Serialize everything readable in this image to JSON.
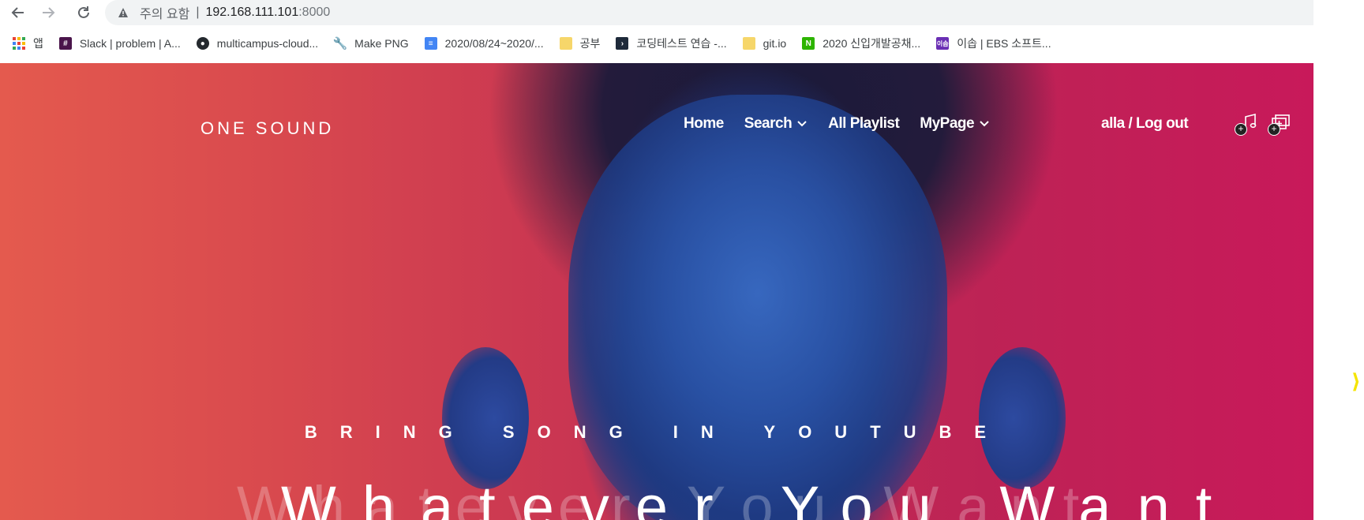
{
  "browser": {
    "security_label": "주의 요함",
    "url_separator": "|",
    "url_host": "192.168.111.101",
    "url_port": ":8000",
    "bookmarks": [
      {
        "label": "앱",
        "icon": "apps-grid-icon"
      },
      {
        "label": "Slack | problem | A...",
        "icon": "slack-icon",
        "color": "#4a154b"
      },
      {
        "label": "multicampus-cloud...",
        "icon": "github-icon",
        "color": "#24292e"
      },
      {
        "label": "Make PNG",
        "icon": "wrench-icon",
        "color": "#5f6368"
      },
      {
        "label": "2020/08/24~2020/...",
        "icon": "google-docs-icon",
        "color": "#4285f4"
      },
      {
        "label": "공부",
        "icon": "folder-icon",
        "color": "#f6d66a"
      },
      {
        "label": "코딩테스트 연습 -...",
        "icon": "programmers-icon",
        "color": "#1e2a3a"
      },
      {
        "label": "git.io",
        "icon": "folder-icon",
        "color": "#f6d66a"
      },
      {
        "label": "2020 신입개발공채...",
        "icon": "naver-icon",
        "color": "#2db400"
      },
      {
        "label": "이솝 | EBS 소프트...",
        "icon": "ebs-icon",
        "color": "#6a2fb4"
      }
    ]
  },
  "site": {
    "logo": "ONE SOUND",
    "nav": [
      {
        "label": "Home",
        "has_dropdown": false
      },
      {
        "label": "Search",
        "has_dropdown": true
      },
      {
        "label": "All Playlist",
        "has_dropdown": false
      },
      {
        "label": "MyPage",
        "has_dropdown": true
      }
    ],
    "user_link": "alla / Log out",
    "header_icons": [
      "add-music-icon",
      "add-playlist-icon"
    ],
    "hero": {
      "tagline": "BRING SONG IN YOUTUBE",
      "headline": "Whatever You Want",
      "headline_ghost": "Whatever You Want"
    }
  },
  "colors": {
    "hero_left": "#e45a4e",
    "hero_right": "#c8195a",
    "face_blue": "#2a53a6",
    "edge_mark": "#f5e400"
  }
}
